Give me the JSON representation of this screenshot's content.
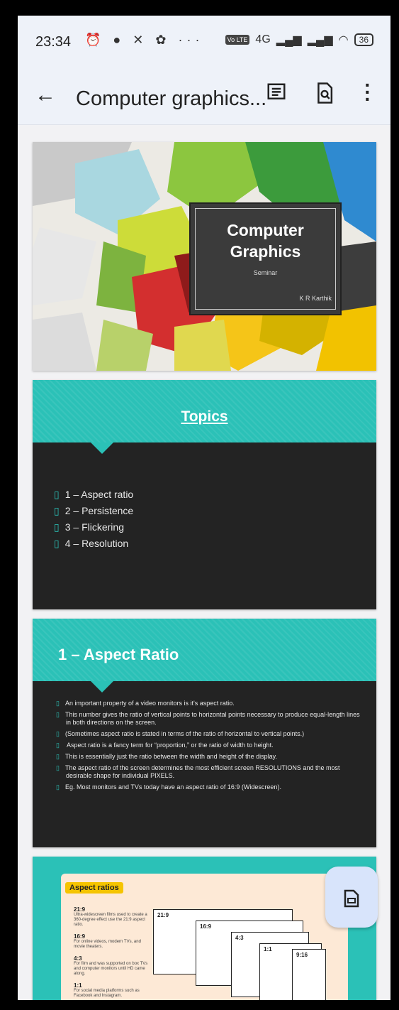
{
  "status_bar": {
    "time": "23:34",
    "notification_icons": "⏰ ● ✕ ✿ ···",
    "network_label": "4G",
    "battery": "36"
  },
  "app_bar": {
    "title": "Computer graphics...",
    "icons": [
      "back-arrow-icon",
      "comment-icon",
      "search-document-icon",
      "more-vert-icon"
    ]
  },
  "slides": {
    "title_slide": {
      "title_line1": "Computer",
      "title_line2": "Graphics",
      "subtitle": "Seminar",
      "author": "K R Karthik"
    },
    "topics_slide": {
      "heading": "Topics",
      "items": [
        "1 – Aspect ratio",
        "2 – Persistence",
        "3 – Flickering",
        "4 – Resolution"
      ]
    },
    "aspect_slide": {
      "heading": "1 – Aspect Ratio",
      "bullets": [
        "An important property of a video monitors is it's aspect ratio.",
        "This number gives the ratio of vertical points to horizontal points necessary to produce equal-length lines in both directions on the screen.",
        "(Sometimes aspect ratio is stated in terms of the ratio of horizontal to vertical points.)",
        " Aspect ratio is a fancy term for “proportion,” or the ratio of width to height.",
        "This is essentially just the ratio between the width and height of the display.",
        "The aspect ratio of the screen determines the most efficient screen RESOLUTIONS and the most desirable shape for individual PIXELS.",
        "Eg. Most monitors and TVs today have an aspect ratio of 16:9 (Widescreen)."
      ]
    },
    "ratios_slide": {
      "badge": "Aspect ratios",
      "ratios": [
        {
          "label": "21:9",
          "desc": "Ultra-widescreen films used to create a 360-degree effect use the 21:9 aspect ratio."
        },
        {
          "label": "16:9",
          "desc": "For online videos, modern TVs, and movie theaters."
        },
        {
          "label": "4:3",
          "desc": "For film and was supported on box TVs and computer monitors until HD came along."
        },
        {
          "label": "1:1",
          "desc": "For social media platforms such as Facebook and Instagram."
        }
      ],
      "boxes": [
        "21:9",
        "16:9",
        "4:3",
        "1:1",
        "9:16"
      ]
    }
  },
  "fab": {
    "icon": "slides-icon"
  }
}
